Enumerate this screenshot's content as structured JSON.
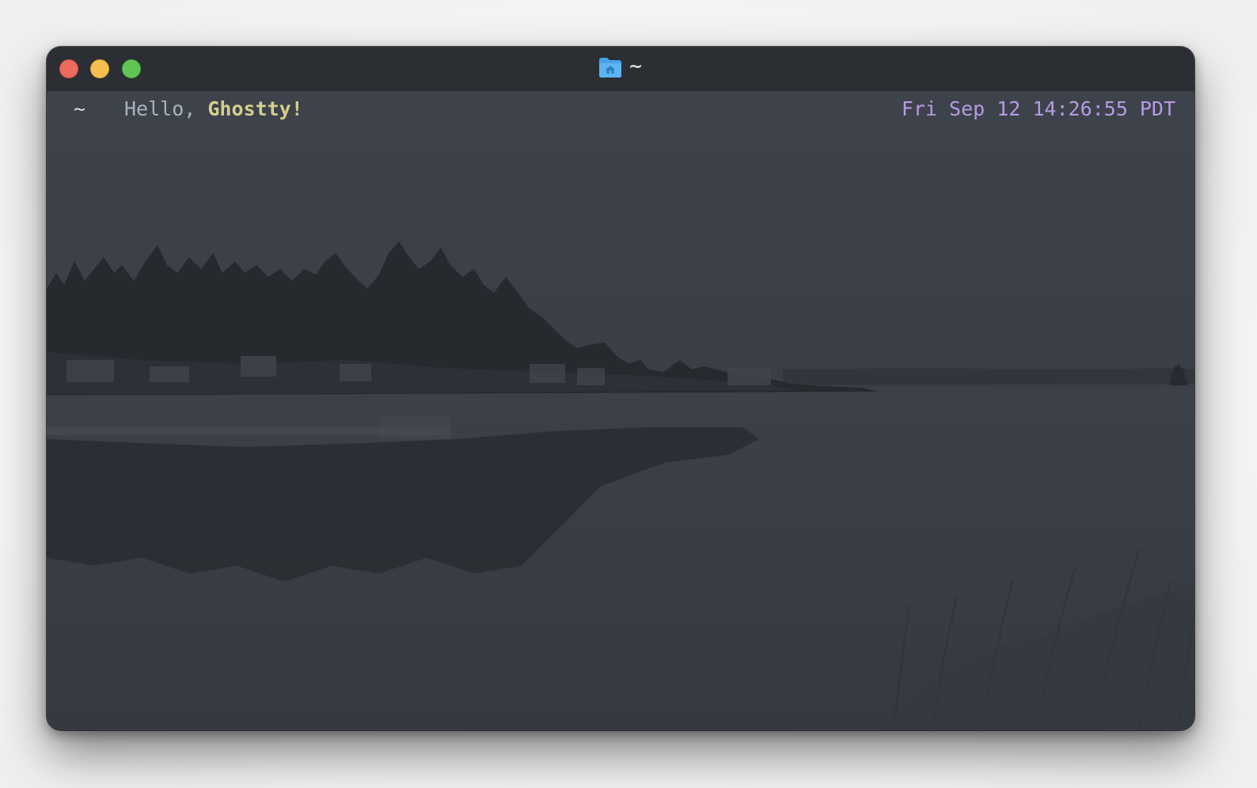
{
  "window": {
    "title": "~",
    "title_icon": "home-folder-icon",
    "traffic_lights": {
      "close_color": "#ed6a5e",
      "minimize_color": "#f5bf4f",
      "maximize_color": "#61c554"
    }
  },
  "terminal": {
    "prompt_dir": "~",
    "greeting_prefix": "Hello, ",
    "greeting_name": "Ghostty!",
    "clock": "Fri Sep 12 14:26:55 PDT"
  },
  "colors": {
    "terminal_bg": "#3b3f47",
    "greeting": "#aab3bc",
    "name": "#d5cf8c",
    "clock": "#b59ae6"
  },
  "background_image": "dim lakeside landscape with forested island, houses and reflections"
}
